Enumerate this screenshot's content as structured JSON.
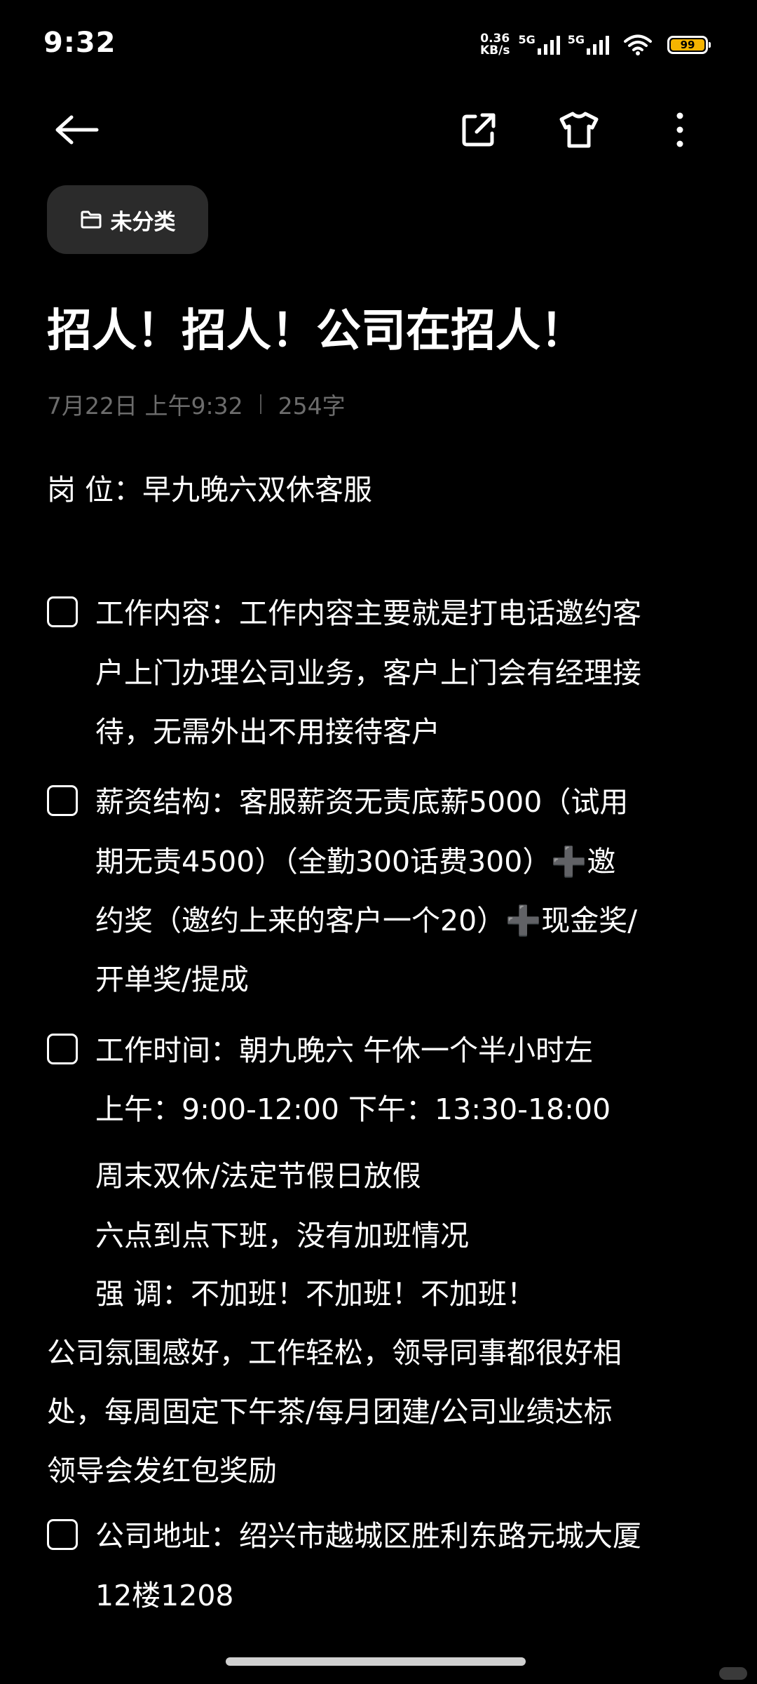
{
  "status_bar": {
    "time": "9:32",
    "net_speed_value": "0.36",
    "net_speed_unit": "KB/s",
    "sim1_label": "5G",
    "sim2_label": "5G",
    "battery": "99"
  },
  "folder": {
    "label": "未分类"
  },
  "note": {
    "title": "招人！招人！公司在招人！",
    "date": "7月22日 上午9:32",
    "word_count": "254字"
  },
  "body": {
    "position_line": "岗        位：早九晚六双休客服",
    "work_content": [
      "工作内容：工作内容主要就是打电话邀约客",
      "户上门办理公司业务，客户上门会有经理接",
      "待，无需外出不用接待客户"
    ],
    "salary": [
      "薪资结构：客服薪资无责底薪5000（试用",
      "期无责4500）（全勤300话费300）➕邀",
      "约奖（邀约上来的客户一个20）➕现金奖/",
      "开单奖/提成"
    ],
    "work_time": [
      "工作时间：朝九晚六  午休一个半小时左",
      "上午：9:00-12:00        下午：13:30-18:00",
      "周末双休/法定节假日放假",
      "六点到点下班，没有加班情况",
      "强        调：不加班！不加班！不加班！"
    ],
    "atmosphere": [
      "公司氛围感好，工作轻松，领导同事都很好相",
      "处，每周固定下午茶/每月团建/公司业绩达标",
      "领导会发红包奖励"
    ],
    "address": [
      "公司地址：绍兴市越城区胜利东路元城大厦",
      "12楼1208"
    ]
  },
  "icons": {
    "back": "back-arrow-icon",
    "share": "share-icon",
    "theme": "tshirt-icon",
    "more": "more-vertical-icon",
    "folder": "folder-icon"
  },
  "colors": {
    "background": "#000000",
    "text": "#ffffff",
    "meta": "#6c6c6c",
    "chip": "#2b2b2b",
    "battery": "#f5b400"
  }
}
